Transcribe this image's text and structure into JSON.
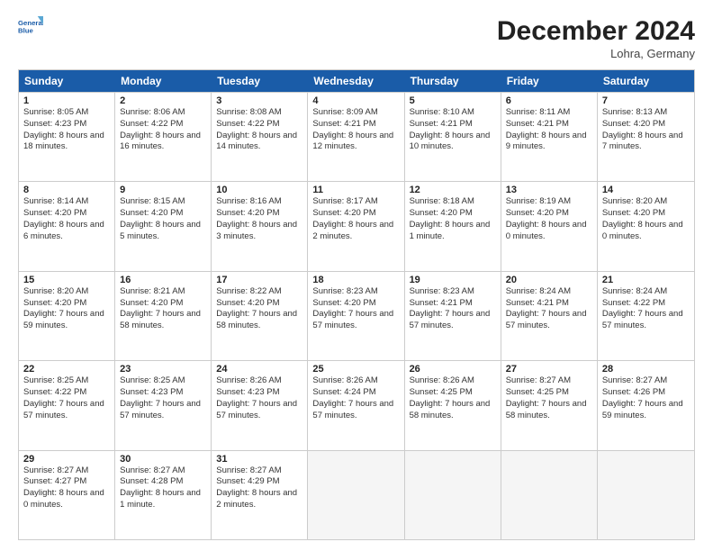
{
  "header": {
    "logo_line1": "General",
    "logo_line2": "Blue",
    "month_year": "December 2024",
    "location": "Lohra, Germany"
  },
  "days_of_week": [
    "Sunday",
    "Monday",
    "Tuesday",
    "Wednesday",
    "Thursday",
    "Friday",
    "Saturday"
  ],
  "weeks": [
    [
      {
        "day": 1,
        "sunrise": "8:05 AM",
        "sunset": "4:23 PM",
        "daylight": "8 hours and 18 minutes"
      },
      {
        "day": 2,
        "sunrise": "8:06 AM",
        "sunset": "4:22 PM",
        "daylight": "8 hours and 16 minutes"
      },
      {
        "day": 3,
        "sunrise": "8:08 AM",
        "sunset": "4:22 PM",
        "daylight": "8 hours and 14 minutes"
      },
      {
        "day": 4,
        "sunrise": "8:09 AM",
        "sunset": "4:21 PM",
        "daylight": "8 hours and 12 minutes"
      },
      {
        "day": 5,
        "sunrise": "8:10 AM",
        "sunset": "4:21 PM",
        "daylight": "8 hours and 10 minutes"
      },
      {
        "day": 6,
        "sunrise": "8:11 AM",
        "sunset": "4:21 PM",
        "daylight": "8 hours and 9 minutes"
      },
      {
        "day": 7,
        "sunrise": "8:13 AM",
        "sunset": "4:20 PM",
        "daylight": "8 hours and 7 minutes"
      }
    ],
    [
      {
        "day": 8,
        "sunrise": "8:14 AM",
        "sunset": "4:20 PM",
        "daylight": "8 hours and 6 minutes"
      },
      {
        "day": 9,
        "sunrise": "8:15 AM",
        "sunset": "4:20 PM",
        "daylight": "8 hours and 5 minutes"
      },
      {
        "day": 10,
        "sunrise": "8:16 AM",
        "sunset": "4:20 PM",
        "daylight": "8 hours and 3 minutes"
      },
      {
        "day": 11,
        "sunrise": "8:17 AM",
        "sunset": "4:20 PM",
        "daylight": "8 hours and 2 minutes"
      },
      {
        "day": 12,
        "sunrise": "8:18 AM",
        "sunset": "4:20 PM",
        "daylight": "8 hours and 1 minute"
      },
      {
        "day": 13,
        "sunrise": "8:19 AM",
        "sunset": "4:20 PM",
        "daylight": "8 hours and 0 minutes"
      },
      {
        "day": 14,
        "sunrise": "8:20 AM",
        "sunset": "4:20 PM",
        "daylight": "8 hours and 0 minutes"
      }
    ],
    [
      {
        "day": 15,
        "sunrise": "8:20 AM",
        "sunset": "4:20 PM",
        "daylight": "7 hours and 59 minutes"
      },
      {
        "day": 16,
        "sunrise": "8:21 AM",
        "sunset": "4:20 PM",
        "daylight": "7 hours and 58 minutes"
      },
      {
        "day": 17,
        "sunrise": "8:22 AM",
        "sunset": "4:20 PM",
        "daylight": "7 hours and 58 minutes"
      },
      {
        "day": 18,
        "sunrise": "8:23 AM",
        "sunset": "4:20 PM",
        "daylight": "7 hours and 57 minutes"
      },
      {
        "day": 19,
        "sunrise": "8:23 AM",
        "sunset": "4:21 PM",
        "daylight": "7 hours and 57 minutes"
      },
      {
        "day": 20,
        "sunrise": "8:24 AM",
        "sunset": "4:21 PM",
        "daylight": "7 hours and 57 minutes"
      },
      {
        "day": 21,
        "sunrise": "8:24 AM",
        "sunset": "4:22 PM",
        "daylight": "7 hours and 57 minutes"
      }
    ],
    [
      {
        "day": 22,
        "sunrise": "8:25 AM",
        "sunset": "4:22 PM",
        "daylight": "7 hours and 57 minutes"
      },
      {
        "day": 23,
        "sunrise": "8:25 AM",
        "sunset": "4:23 PM",
        "daylight": "7 hours and 57 minutes"
      },
      {
        "day": 24,
        "sunrise": "8:26 AM",
        "sunset": "4:23 PM",
        "daylight": "7 hours and 57 minutes"
      },
      {
        "day": 25,
        "sunrise": "8:26 AM",
        "sunset": "4:24 PM",
        "daylight": "7 hours and 57 minutes"
      },
      {
        "day": 26,
        "sunrise": "8:26 AM",
        "sunset": "4:25 PM",
        "daylight": "7 hours and 58 minutes"
      },
      {
        "day": 27,
        "sunrise": "8:27 AM",
        "sunset": "4:25 PM",
        "daylight": "7 hours and 58 minutes"
      },
      {
        "day": 28,
        "sunrise": "8:27 AM",
        "sunset": "4:26 PM",
        "daylight": "7 hours and 59 minutes"
      }
    ],
    [
      {
        "day": 29,
        "sunrise": "8:27 AM",
        "sunset": "4:27 PM",
        "daylight": "8 hours and 0 minutes"
      },
      {
        "day": 30,
        "sunrise": "8:27 AM",
        "sunset": "4:28 PM",
        "daylight": "8 hours and 1 minute"
      },
      {
        "day": 31,
        "sunrise": "8:27 AM",
        "sunset": "4:29 PM",
        "daylight": "8 hours and 2 minutes"
      },
      null,
      null,
      null,
      null
    ]
  ]
}
